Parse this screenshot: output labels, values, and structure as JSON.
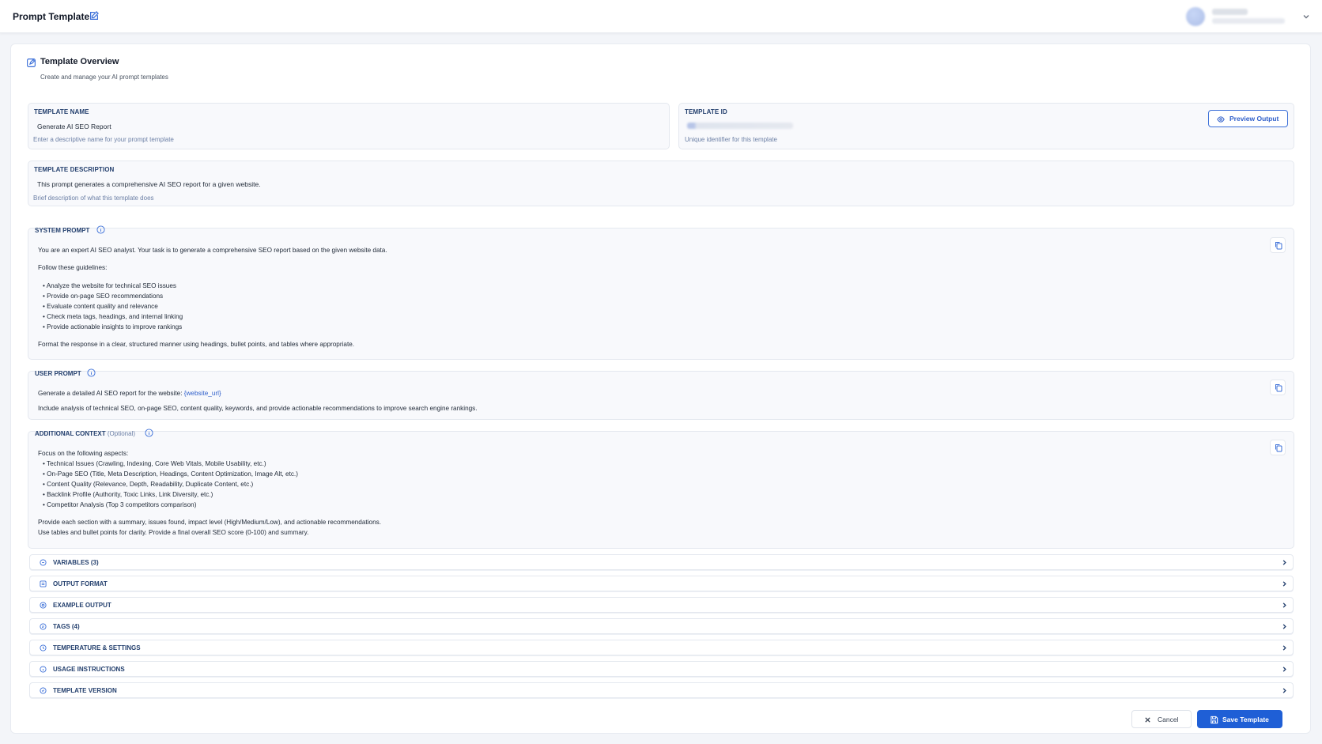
{
  "header": {
    "title": "Prompt Template",
    "edit_icon": "edit-icon",
    "user_icon": "avatar",
    "menu_icon": "chevron-down-icon"
  },
  "overview": {
    "title": "Template Overview",
    "subtitle": "Create and manage your AI prompt templates",
    "icon": "edit-square-icon"
  },
  "template_name": {
    "label": "TEMPLATE NAME",
    "value": "Generate AI SEO Report",
    "help": "Enter a descriptive name for your prompt template"
  },
  "template_id": {
    "label": "TEMPLATE ID",
    "help": "Unique identifier for this template"
  },
  "preview_button": {
    "label": "Preview Output",
    "icon": "eye-icon"
  },
  "template_description": {
    "label": "TEMPLATE DESCRIPTION",
    "value": "This prompt generates a comprehensive AI SEO report for a given website.",
    "help": "Brief description of what this template does"
  },
  "system_prompt": {
    "label": "SYSTEM PROMPT",
    "intro": "You are an expert AI SEO analyst. Your task is to generate a comprehensive SEO report based on the given website data.",
    "guidelines_heading": "Follow these guidelines:",
    "bullets": [
      "Analyze the website for technical SEO issues",
      "Provide on-page SEO recommendations",
      "Evaluate content quality and relevance",
      "Check meta tags, headings, and internal linking",
      "Provide actionable insights to improve rankings"
    ],
    "closing": "Format the response in a clear, structured manner using headings, bullet points, and tables where appropriate."
  },
  "user_prompt": {
    "label": "USER PROMPT",
    "line1_prefix": "Generate a detailed AI SEO report for the website: ",
    "line1_variable": "{website_url}",
    "line2": "Include analysis of technical SEO, on-page SEO, content quality, keywords, and provide actionable recommendations to improve search engine rankings."
  },
  "additional_context": {
    "label": "ADDITIONAL CONTEXT",
    "optional": "(Optional)",
    "heading": "Focus on the following aspects:",
    "bullets": [
      "Technical Issues (Crawling, Indexing, Core Web Vitals, Mobile Usability, etc.)",
      "On-Page SEO (Title, Meta Description, Headings, Content Optimization, Image Alt, etc.)",
      "Content Quality (Relevance, Depth, Readability, Duplicate Content, etc.)",
      "Backlink Profile (Authority, Toxic Links, Link Diversity, etc.)",
      "Competitor Analysis (Top 3 competitors comparison)"
    ],
    "closing1": "Provide each section with a summary, issues found, impact level (High/Medium/Low), and actionable recommendations.",
    "closing2": "Use tables and bullet points for clarity. Provide a final overall SEO score (0-100) and summary."
  },
  "accordions": [
    {
      "label": "VARIABLES (3)",
      "icon": "variables-icon"
    },
    {
      "label": "OUTPUT FORMAT",
      "icon": "output-format-icon"
    },
    {
      "label": "EXAMPLE OUTPUT",
      "icon": "example-output-icon"
    },
    {
      "label": "TAGS (4)",
      "icon": "tags-icon"
    },
    {
      "label": "TEMPERATURE & SETTINGS",
      "icon": "settings-icon"
    },
    {
      "label": "USAGE INSTRUCTIONS",
      "icon": "usage-instructions-icon"
    },
    {
      "label": "TEMPLATE VERSION",
      "icon": "template-version-icon"
    }
  ],
  "footer": {
    "cancel_label": "Cancel",
    "save_label": "Save Template"
  },
  "colors": {
    "accent": "#1f5fd6",
    "label": "#24406e",
    "background": "#f3f5f9"
  }
}
